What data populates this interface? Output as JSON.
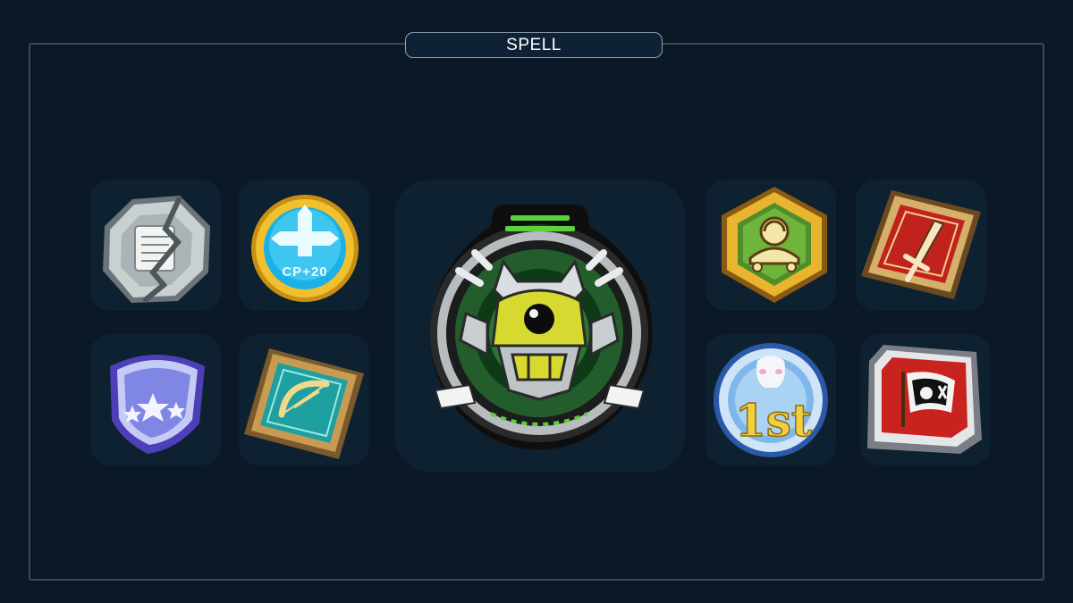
{
  "panel": {
    "title": "SPELL"
  },
  "icons": {
    "scroll": "broken-scroll-icon",
    "cp_coin": "cp-plus-coin-icon",
    "cp_coin_text": "CP+20",
    "shield": "star-shield-icon",
    "bow": "bow-card-icon",
    "featured": "robot-mask-medallion-icon",
    "turtle": "turtle-hexagon-icon",
    "sword": "sword-card-icon",
    "first_place": "first-place-medal-icon",
    "first_place_text": "1st",
    "pirate": "pirate-flag-card-icon"
  }
}
